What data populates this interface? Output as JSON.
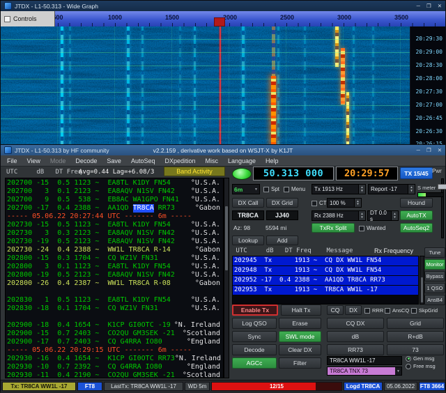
{
  "icons": {
    "minimize": "─",
    "maximize": "❐",
    "close": "✕",
    "dropdown": "▼",
    "spin_up": "▲",
    "spin_down": "▼"
  },
  "wide_graph": {
    "title": "JTDX - L1-50.313 - Wide Graph",
    "controls_label": "Controls",
    "freq_ticks": [
      "500",
      "1000",
      "1500",
      "2000",
      "2500",
      "3000",
      "3500"
    ],
    "timestamps": [
      "20:29:30",
      "20:29:00",
      "20:28:30",
      "20:28:00",
      "20:27:30",
      "20:27:00",
      "20:26:45",
      "20:26:30",
      "20:26:15"
    ]
  },
  "main_window": {
    "title": "JTDX - L1-50.313  by HF community",
    "version": "v2.2.159 , derivative work based on WSJT-X by K1JT",
    "menus": [
      {
        "label": "File"
      },
      {
        "label": "View"
      },
      {
        "label": "Mode",
        "state": "disabled"
      },
      {
        "label": "Decode"
      },
      {
        "label": "Save"
      },
      {
        "label": "AutoSeq"
      },
      {
        "label": "DXpedition"
      },
      {
        "label": "Misc"
      },
      {
        "label": "Language"
      },
      {
        "label": "Help"
      }
    ]
  },
  "band_activity": {
    "columns": "UTC     dB   DT Freq",
    "avg": "Avg=0.44 Lag=+6.08/3",
    "label": "Band Activity",
    "rows": [
      {
        "pre": "202700 -15  0.5 1123 ~  EA8TL K1DY FN54",
        "country": "°U.S.A."
      },
      {
        "pre": "202700   3  0.1 2123 ~  EA8AQV N1SV FN42",
        "country": "°U.S.A."
      },
      {
        "pre": "202700   9  0.5  538 ~  EB8AC WA1GPO FN41",
        "country": "°U.S.A."
      },
      {
        "pre": "202700 -17  0.4 2388 ~  AA1QD ",
        "hl": "TR8CA",
        "post": " RR73",
        "country": "°Gabon"
      },
      {
        "pre": "----- 05.06.22 20:27:44 UTC ------- 6m -----",
        "type": "sep"
      },
      {
        "pre": "202730 -15  0.5 1123 ~  EA8TL K1DY FN54",
        "country": "°U.S.A."
      },
      {
        "pre": "202730   3  0.3 2123 ~  EA8AQV N1SV FN42",
        "country": "°U.S.A."
      },
      {
        "pre": "202730 -19  0.5 2123 ~  EA8AQV N1SV FN42",
        "country": "°U.S.A."
      },
      {
        "pre": "202730 -24  0.4 2388 ~  WW1L TR8CA R-14",
        "country": "°Gabon",
        "type": "own"
      },
      {
        "pre": "202800 -15  0.3 1704 ~  CQ WZ1V FN31",
        "country": "°U.S.A."
      },
      {
        "pre": "202800   3  0.1 1123 ~  EA8TL K1DY FN54",
        "country": "°U.S.A."
      },
      {
        "pre": "202800 -19  0.5 2123 ~  EA8AQV N1SV FN42",
        "country": "°U.S.A."
      },
      {
        "pre": "202800 -26  0.4 2387 ~  WW1L TR8CA R-08",
        "country": "°Gabon",
        "type": "own"
      },
      {
        "pre": ""
      },
      {
        "pre": "202830   1  0.5 1123 ~  EA8TL K1DY FN54",
        "country": "°U.S.A."
      },
      {
        "pre": "202830 -18  0.1 1704 ~  CQ WZ1V FN31",
        "country": "°U.S.A."
      },
      {
        "pre": ""
      },
      {
        "pre": "202900 -18  0.4 1654 ~  K1CP GI0OTC -19",
        "country": "°N. Ireland"
      },
      {
        "pre": "202900 -15  0.7 2403 ~  CO2QU GM3SEK -21",
        "country": "°Scotland"
      },
      {
        "pre": "202900 -17  0.7 2403 ~  CQ G4RRA IO80",
        "country": "°England"
      },
      {
        "pre": "----- 05.06.22 20:29:15 UTC ------- 6m -----",
        "type": "sep"
      },
      {
        "pre": "202930 -16  0.4 1654 ~  K1CP GI0OTC RR73",
        "country": "°N. Ireland"
      },
      {
        "pre": "202930 -10  0.7 2392 ~  CQ G4RRA IO80",
        "country": "°England"
      },
      {
        "pre": "202930 -11  0.4 2190 ~  CO2QU GM3SEK -21",
        "country": "°Scotland"
      }
    ]
  },
  "rx_frequency": {
    "columns": " UTC     dB   DT Freq    Message",
    "label": "Rx Frequency",
    "rows": [
      {
        "text": "202945  Tx      1913 ~  CQ DX WW1L FN54",
        "type": "tx"
      },
      {
        "text": "202948  Tx      1913 ~  CQ DX WW1L FN54",
        "type": "tx"
      },
      {
        "text": "202952 -17  0.4 2388 ~  AA1QD TR8CA RR73",
        "type": "rx"
      },
      {
        "text": "202953  Tx      1913 ~  TR8CA WW1L -17",
        "type": "tx"
      }
    ]
  },
  "radio": {
    "freq_display": "50.313 000",
    "clock": "20:29:57",
    "tx_cycle_button": "TX 15/45",
    "band": "6m",
    "spt": "Spt",
    "menu": "Menu",
    "tx_freq": "Tx 1913 Hz",
    "report": "Report -17",
    "smeter": "S meter",
    "dx_call_button": "DX Call",
    "dx_grid_button": "DX Grid",
    "dx_call": "TR8CA",
    "dx_grid": "JJ40",
    "ct": "CT",
    "ct_pct": "100 %",
    "hound": "Hound",
    "rx_freq": "Rx 2388 Hz",
    "dt": "DT 0.0 s",
    "autotx": "AutoTX",
    "az": "Az: 98",
    "distance": "5594 mi",
    "txrx_split": "TxRx Split",
    "wanted": "Wanted",
    "autoseq2": "AutoSeq2",
    "lookup": "Lookup",
    "add": "Add",
    "pwr": "Pwr"
  },
  "right_buttons": {
    "tune": "Tune",
    "monitor": "Monitor",
    "bypass": "Bypass",
    "qso1": "1 QSO",
    "ansb4": "AnsB4"
  },
  "tx_controls": {
    "enable_tx": "Enable Tx",
    "halt_tx": "Halt Tx",
    "log_qso": "Log QSO",
    "erase": "Erase",
    "sync": "Sync",
    "swl_mode": "SWL mode",
    "decode": "Decode",
    "clear_dx": "Clear DX",
    "agcc": "AGCc",
    "filter": "Filter"
  },
  "msg_buttons": {
    "cq": "CQ",
    "dx": "DX",
    "rrr": "RRR",
    "anscq": "AnsCQ",
    "skpgrid": "SkpGrid",
    "cq_dx": "CQ DX",
    "grid": "Grid",
    "db": "dB",
    "r_db": "R+dB",
    "rr73": "RR73",
    "b73": "73",
    "gen_msg_value": "TR8CA WW1L -17",
    "gen_msg": "Gen msg",
    "free_msg": "Free msg",
    "free_msg_value": "TR8CA TNX 73"
  },
  "status_bar": {
    "tx_msg": "Tx: TR8CA WW1L -17",
    "mode": "FT8",
    "last_tx": "LastTx: TR8CA WW1L -17",
    "wd": "WD 5m",
    "progress": "12/15",
    "logged": "Logd TR8CA",
    "date": "05.06.2022",
    "decodes": "FT8 3664"
  },
  "colors": {
    "decode_green": "#00c800",
    "alert_orange": "#ff4f26",
    "own_call_yellow": "#cbe25a",
    "selection_blue": "#2050ff",
    "tx_row_blue": "#0019d0",
    "freq_cyan": "#40e0ff",
    "clock_orange": "#ffa126",
    "accent_green": "#35a04a",
    "accent_blue": "#1565d8",
    "free_msg_pink": "#c77bd4",
    "progress_red": "#dd1111",
    "band_activity_olive": "#77771d"
  }
}
